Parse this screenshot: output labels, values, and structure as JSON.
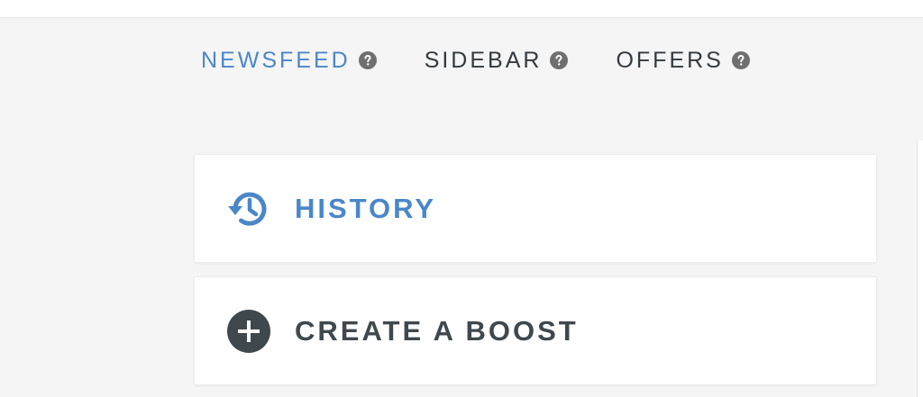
{
  "nav": {
    "tabs": [
      {
        "label": "NEWSFEED",
        "active": true,
        "icon": "help-icon"
      },
      {
        "label": "SIDEBAR",
        "active": false,
        "icon": "help-icon"
      },
      {
        "label": "OFFERS",
        "active": false,
        "icon": "help-icon"
      }
    ]
  },
  "cards": {
    "history": {
      "label": "HISTORY",
      "icon": "history-icon"
    },
    "boost": {
      "label": "CREATE A BOOST",
      "icon": "add-circle-icon"
    }
  },
  "colors": {
    "accent": "#4a87c8",
    "text_dark": "#333a3e",
    "icon_dark": "#3f484d",
    "help_icon": "#6f6f6f",
    "background": "#f5f5f5",
    "card": "#ffffff"
  }
}
